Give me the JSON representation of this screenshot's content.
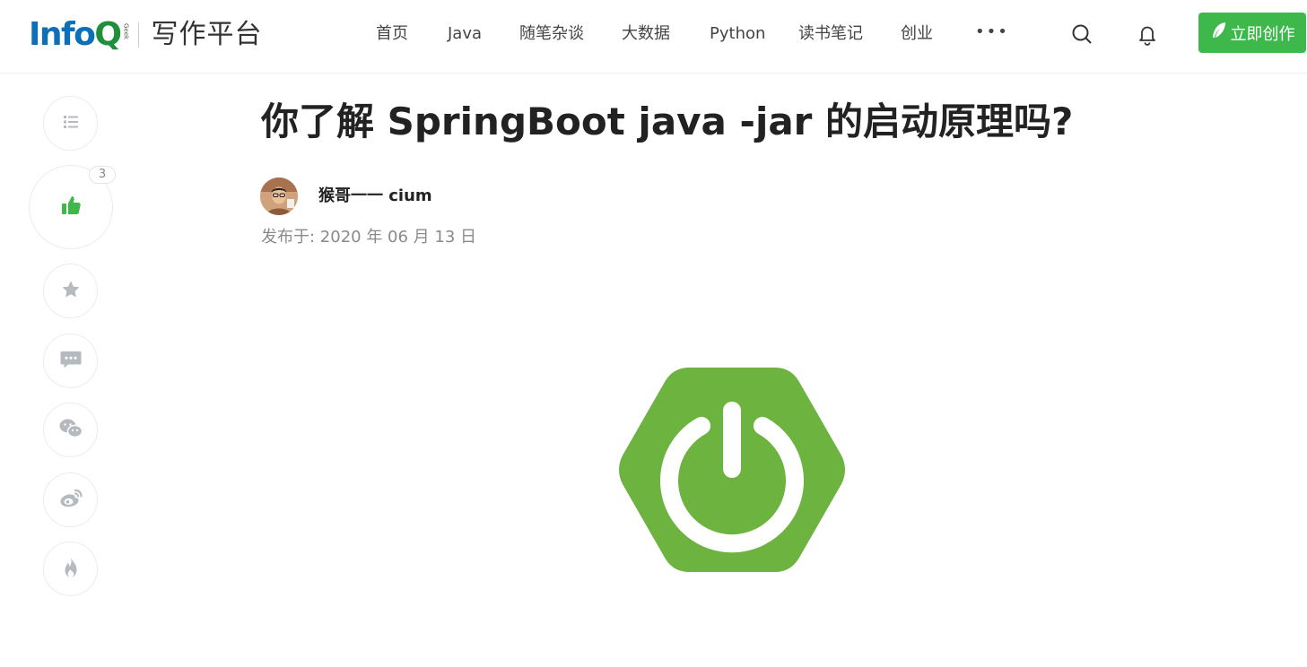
{
  "header": {
    "logo_brand_main": "Info",
    "logo_brand_q": "Q",
    "logo_tag": "Geek",
    "logo_platform": "写作平台",
    "nav": [
      "首页",
      "Java",
      "随笔杂谈",
      "大数据",
      "Python",
      "读书笔记",
      "创业"
    ],
    "more": "•••",
    "create_label": "立即创作",
    "accent": "#3fb84b"
  },
  "sidebar": {
    "items": [
      "list-icon",
      "like-icon",
      "star-icon",
      "comment-icon",
      "wechat-icon",
      "weibo-icon",
      "fire-icon"
    ],
    "like_count": "3"
  },
  "article": {
    "title": "你了解 SpringBoot java -jar 的启动原理吗?",
    "author": "猴哥一一 cium",
    "published": "发布于: 2020 年 06 月 13 日",
    "image": "spring-power-icon",
    "image_color": "#6db33f"
  }
}
